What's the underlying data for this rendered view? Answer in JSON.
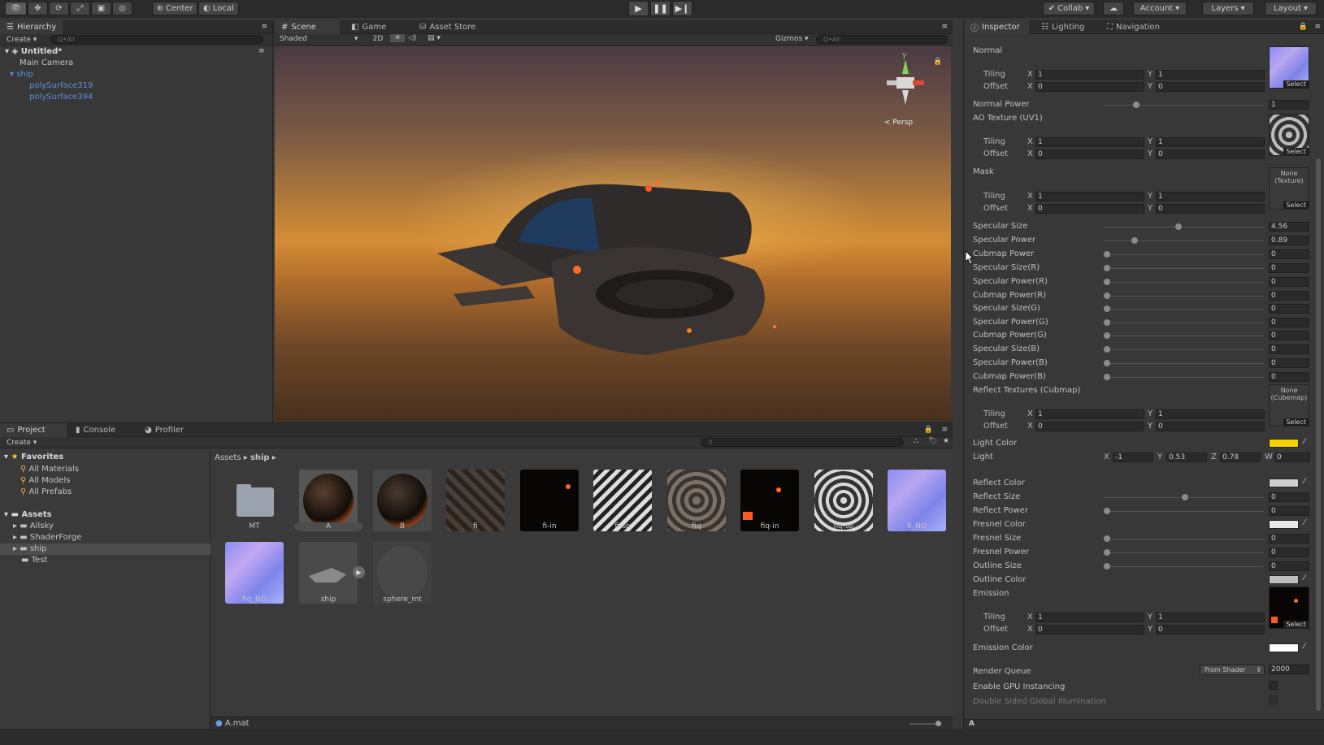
{
  "toolbar": {
    "center": "Center",
    "local": "Local",
    "collab": "Collab",
    "account": "Account",
    "layers": "Layers",
    "layout": "Layout"
  },
  "hierarchy": {
    "tab": "Hierarchy",
    "create": "Create",
    "search_placeholder": "Q•All",
    "scene": "Untitled*",
    "items": [
      "Main Camera",
      "ship",
      "polySurface319",
      "polySurface394"
    ]
  },
  "scene": {
    "tabs": [
      "Scene",
      "Game",
      "Asset Store"
    ],
    "shaded": "Shaded",
    "mode2d": "2D",
    "gizmos": "Gizmos",
    "search_placeholder": "Q•All",
    "persp": "< Persp",
    "gizmo_y": "y"
  },
  "project": {
    "tabs": [
      "Project",
      "Console",
      "Profiler"
    ],
    "create": "Create",
    "favorites": "Favorites",
    "favorites_items": [
      "All Materials",
      "All Models",
      "All Prefabs"
    ],
    "assets": "Assets",
    "asset_folders": [
      "Allsky",
      "ShaderForge",
      "ship",
      "Test"
    ],
    "breadcrumb_root": "Assets",
    "breadcrumb_current": "ship",
    "grid_row1": [
      "MT",
      "A",
      "B",
      "fi",
      "fi-in",
      "fi-sp",
      "fiq",
      "fiq-in",
      "fiq-sp",
      "fi_NO"
    ],
    "grid_row2": [
      "fiq_NO",
      "ship",
      "sphere_mt"
    ],
    "selected_file": "A.mat"
  },
  "inspector": {
    "tabs": [
      "Inspector",
      "Lighting",
      "Navigation"
    ],
    "normal": "Normal",
    "tiling": "Tiling",
    "offset": "Offset",
    "x": "X",
    "y": "Y",
    "z": "Z",
    "w": "W",
    "one": "1",
    "zero": "0",
    "select": "Select",
    "normal_power": "Normal Power",
    "normal_power_value": "1",
    "ao_texture": "AO Texture (UV1)",
    "mask": "Mask",
    "none_texture": "None (Texture)",
    "specular_size": "Specular Size",
    "specular_size_value": "4.56",
    "specular_power": "Specular Power",
    "specular_power_value": "0.89",
    "zero_rows": [
      "Cubmap Power",
      "Specular Size(R)",
      "Specular Power(R)",
      "Cubmap Power(R)",
      "Specular Size(G)",
      "Specular Power(G)",
      "Cubmap Power(G)",
      "Specular Size(B)",
      "Specular Power(B)",
      "Cubmap Power(B)"
    ],
    "reflect_textures": "Reflect Textures (Cubmap)",
    "none_cubemap": "None (Cubemap)",
    "light_color": "Light Color",
    "light": "Light",
    "light_x": "-1",
    "light_y": "0.53",
    "light_z": "0.78",
    "light_w": "0",
    "reflect_color": "Reflect Color",
    "reflect_size": "Reflect Size",
    "reflect_power": "Reflect Power",
    "fresnel_color": "Fresnel Color",
    "fresnel_size": "Fresnel Size",
    "fresnel_power": "Fresnel Power",
    "outline_size": "Outline Size",
    "outline_color": "Outline Color",
    "emission": "Emission",
    "emission_color": "Emission Color",
    "render_queue": "Render Queue",
    "render_queue_mode": "From Shader",
    "render_queue_value": "2000",
    "gpu_instancing": "Enable GPU Instancing",
    "double_sided_gi": "Double Sided Global Illumination",
    "footer": "A"
  },
  "colors": {
    "light_color": "#f5d000",
    "reflect_color": "#cfcfcf",
    "fresnel_color": "#e8e8e8",
    "outline_color": "#bdbdbd",
    "emission_color": "#ffffff"
  }
}
